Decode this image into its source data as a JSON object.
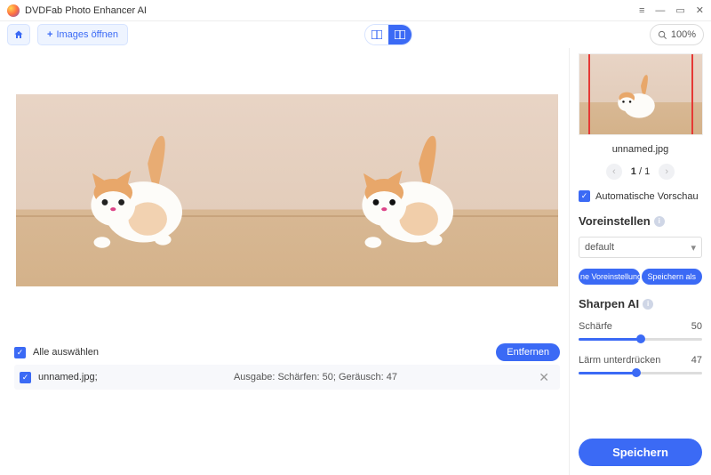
{
  "app": {
    "title": "DVDFab Photo Enhancer AI"
  },
  "toolbar": {
    "open_images": "Images öffnen",
    "zoom": "100%"
  },
  "filelist": {
    "select_all": "Alle auswählen",
    "remove": "Entfernen",
    "file_name": "unnamed.jpg;",
    "output_info": "Ausgabe: Schärfen: 50; Geräusch: 47"
  },
  "right": {
    "thumb_name": "unnamed.jpg",
    "page_current": "1",
    "page_sep": "/",
    "page_total": "1",
    "auto_preview": "Automatische Vorschau",
    "presets_heading": "Voreinstellen",
    "preset_selected": "default",
    "save_preset": "ne Voreinstellung speich",
    "save_as": "Speichern als",
    "sharpen_heading": "Sharpen AI",
    "sharpness_label": "Schärfe",
    "sharpness_value": "50",
    "noise_label": "Lärm unterdrücken",
    "noise_value": "47",
    "save": "Speichern"
  },
  "colors": {
    "accent": "#3b6af5"
  }
}
